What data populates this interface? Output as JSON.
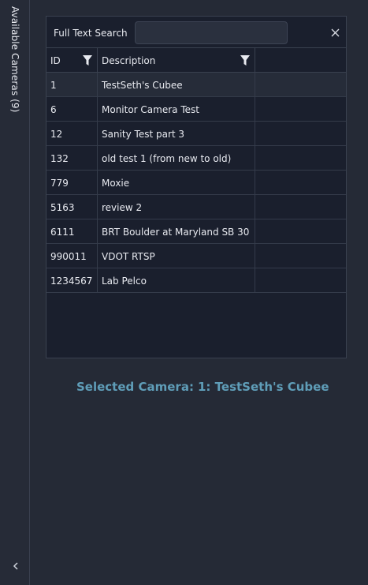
{
  "sidebar": {
    "title": "Available Cameras (9)"
  },
  "search": {
    "label": "Full Text Search",
    "value": "",
    "placeholder": ""
  },
  "table": {
    "columns": [
      "ID",
      "Description"
    ],
    "rows": [
      {
        "id": "1",
        "description": "TestSeth's Cubee"
      },
      {
        "id": "6",
        "description": "Monitor Camera Test"
      },
      {
        "id": "12",
        "description": "Sanity Test part 3"
      },
      {
        "id": "132",
        "description": "old test 1 (from new to old)"
      },
      {
        "id": "779",
        "description": "Moxie"
      },
      {
        "id": "5163",
        "description": "review 2"
      },
      {
        "id": "6111",
        "description": "BRT Boulder at Maryland SB 30"
      },
      {
        "id": "990011",
        "description": "VDOT RTSP"
      },
      {
        "id": "1234567",
        "description": "Lab Pelco"
      }
    ],
    "selected_index": 0
  },
  "selection": {
    "label": "Selected Camera:",
    "value": "1: TestSeth's Cubee"
  },
  "colors": {
    "background": "#252a36",
    "panel": "#1a1f2d",
    "accent": "#5f9db8",
    "selected_row": "#262c39"
  },
  "icons": {
    "filter": "filter-icon",
    "close": "close-icon",
    "collapse": "chevron-left-icon"
  }
}
